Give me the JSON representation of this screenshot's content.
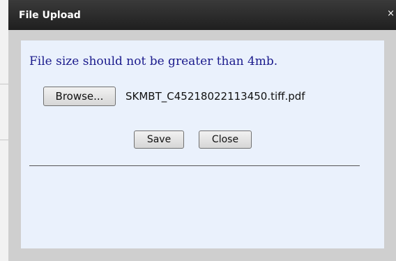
{
  "dialog": {
    "title": "File Upload",
    "close_glyph": "×",
    "info_text": "File size should not be greater than 4mb.",
    "browse_label": "Browse...",
    "file_name": "SKMBT_C45218022113450.tiff.pdf",
    "save_label": "Save",
    "close_label": "Close"
  }
}
